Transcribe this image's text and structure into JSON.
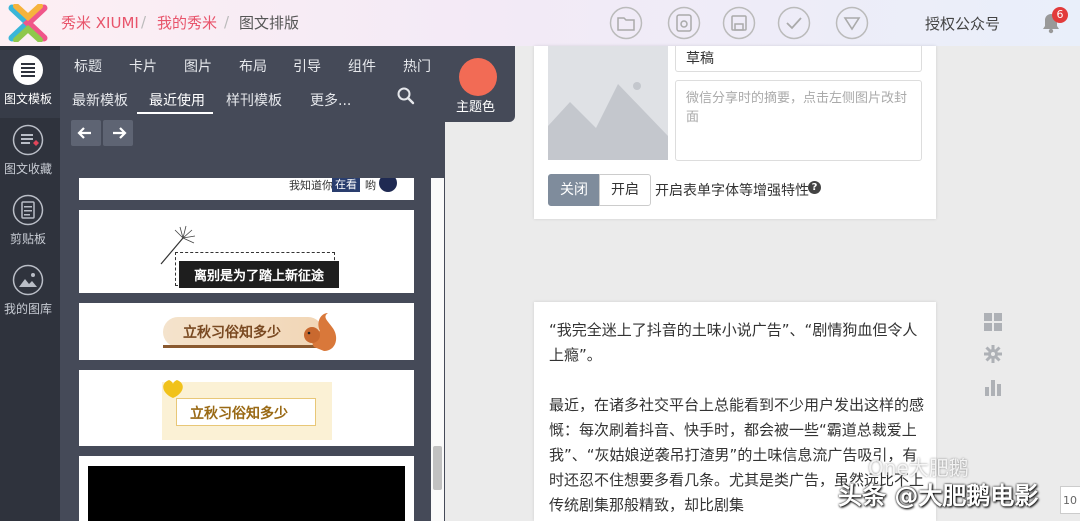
{
  "header": {
    "breadcrumbs": [
      {
        "label": "秀米 XIUMI"
      },
      {
        "label": "我的秀米"
      },
      {
        "label": "图文排版"
      }
    ],
    "separator": "/",
    "auth_label": "授权公众号",
    "notification_count": "6"
  },
  "rail": {
    "items": [
      {
        "label": "图文模板",
        "icon": "template-icon"
      },
      {
        "label": "图文收藏",
        "icon": "favorite-icon"
      },
      {
        "label": "剪贴板",
        "icon": "clipboard-icon"
      },
      {
        "label": "我的图库",
        "icon": "gallery-icon"
      }
    ]
  },
  "panel": {
    "categories": [
      "标题",
      "卡片",
      "图片",
      "布局",
      "引导",
      "组件",
      "热门"
    ],
    "subtabs": [
      "最新模板",
      "最近使用",
      "样刊模板",
      "更多..."
    ],
    "active_subtab": "最近使用",
    "theme_label": "主题色",
    "theme_color": "#f26b55"
  },
  "templates": {
    "t1_small": "我知道你",
    "t1_tag": "在看",
    "t1_tail": "哟",
    "t2_title": "离别是为了踏上新征途",
    "t3_title": "立秋习俗知多少",
    "t4_title": "立秋习俗知多少"
  },
  "editor": {
    "draft_value": "草稿",
    "summary_placeholder": "微信分享时的摘要，点击左侧图片改封面",
    "toggle_off": "关闭",
    "toggle_on": "开启",
    "font_option_label": "开启表单字体等增强特性",
    "help": "?"
  },
  "article": {
    "p1": "“我完全迷上了抖音的土味小说广告”、“剧情狗血但令人上瘾”。",
    "p2": "最近，在诸多社交平台上总能看到不少用户发出这样的感慨：每次刷着抖音、快手时，都会被一些“霸道总裁爱上我”、“灰姑娘逆袭吊打渣男”的土味信息流广告吸引，有时还忍不住想要多看几条。尤其是类广告，虽然远比不上传统剧集那般精致，却比剧集"
  },
  "watermark": {
    "line1": "One大肥鹅",
    "line2": "头条 @大肥鹅电影"
  },
  "zoom": "10"
}
